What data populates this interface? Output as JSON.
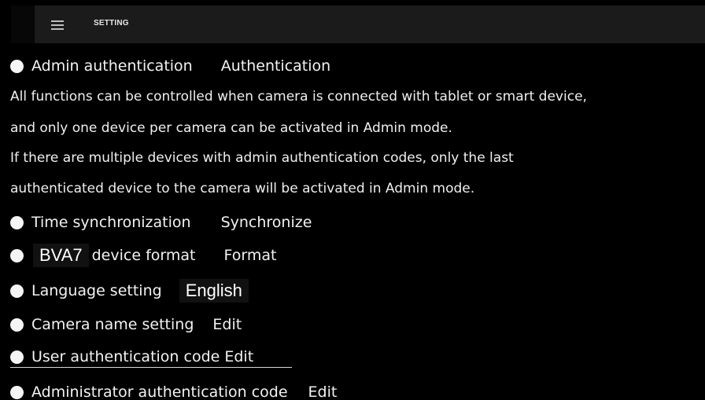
{
  "header": {
    "title": "SETTING",
    "menu_icon": "hamburger-menu-icon"
  },
  "admin_auth": {
    "label": "Admin authentication",
    "action": "Authentication"
  },
  "description": {
    "line1": "All functions can be controlled when camera is connected with tablet or smart device,",
    "line2": "and only one device per camera can be activated in Admin mode.",
    "line3": "If there are multiple devices with admin authentication codes, only the last",
    "line4": "authenticated device to the camera will be activated in Admin mode."
  },
  "time_sync": {
    "label": "Time synchronization",
    "action": "Synchronize"
  },
  "device_format": {
    "model": "BVA7",
    "label": "device format",
    "action": "Format"
  },
  "language": {
    "label": "Language setting",
    "value": "English"
  },
  "camera_name": {
    "label": "Camera name setting",
    "action": "Edit"
  },
  "user_auth_code": {
    "label": "User authentication code Edit"
  },
  "admin_auth_code": {
    "label": "Administrator authentication code",
    "action": "Edit"
  },
  "colors": {
    "background": "#000000",
    "header": "#1b1b1b",
    "text": "#f2f2f2"
  }
}
